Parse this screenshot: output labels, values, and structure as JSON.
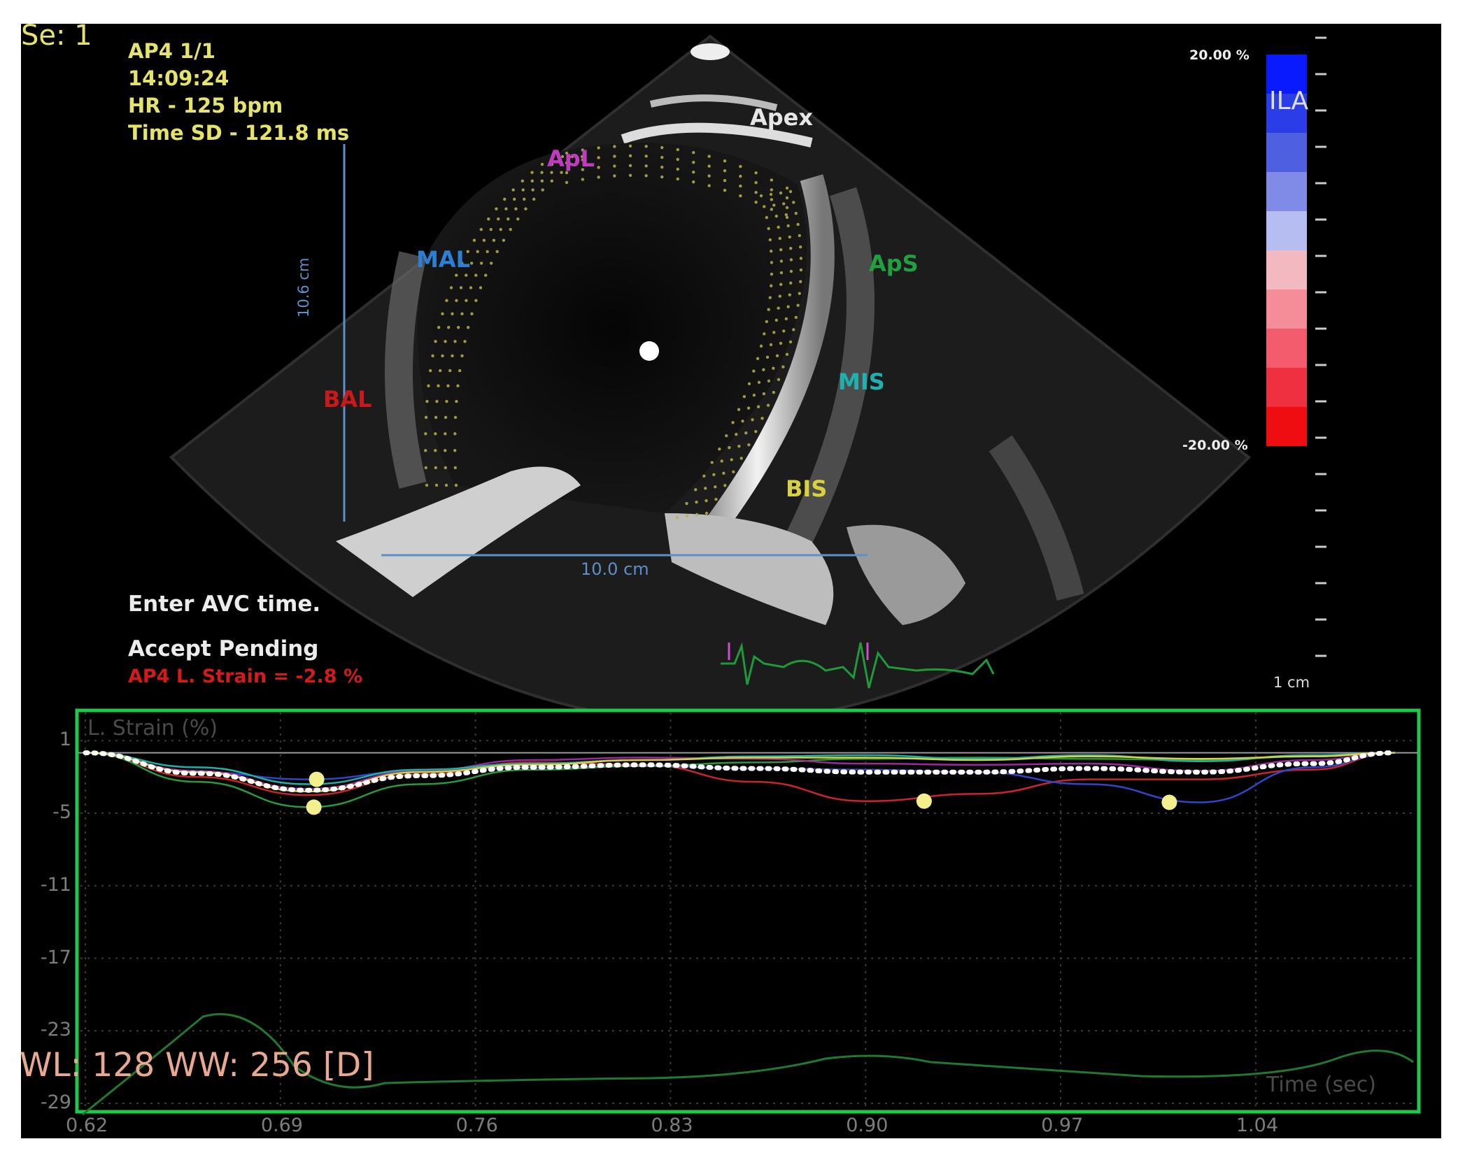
{
  "header": {
    "series": "Se: 1",
    "view": "AP4  1/1",
    "time": "14:09:24",
    "heart_rate": "HR - 125 bpm",
    "time_sd": "Time SD - 121.8 ms"
  },
  "image_labels": {
    "apex": "Apex",
    "apl": "ApL",
    "aps": "ApS",
    "mal": "MAL",
    "mis": "MIS",
    "bal": "BAL",
    "bis": "BIS",
    "depth": "10.6 cm",
    "width": "10.0 cm"
  },
  "color_scale": {
    "max_label": "20.00 %",
    "min_label": "-20.00 %",
    "overlay": "ILA",
    "depth_scale": "1 cm",
    "colors": [
      "#0a1aff",
      "#2a3de6",
      "#4e5fe0",
      "#7f8be6",
      "#b6bdf0",
      "#f3b9c1",
      "#f58d99",
      "#f25c6d",
      "#ef3040",
      "#f00d12"
    ]
  },
  "messages": {
    "prompt": "Enter AVC time.",
    "status": "Accept Pending",
    "strain": "AP4 L. Strain = -2.8 %"
  },
  "ecg_color": "#1f9a3a",
  "window_level": "WL: 128 WW: 256 [D]",
  "chart_data": {
    "type": "line",
    "ylabel": "L. Strain (%)",
    "xlabel": "Time (sec)",
    "yticks": [
      "1",
      "-5",
      "-11",
      "-17",
      "-23",
      "-29"
    ],
    "xticks": [
      "0.62",
      "0.69",
      "0.76",
      "0.83",
      "0.90",
      "0.97",
      "1.04"
    ],
    "xlim": [
      0.62,
      1.092
    ],
    "ylim": [
      -30.5,
      2
    ],
    "x": [
      0.62,
      0.66,
      0.7,
      0.74,
      0.78,
      0.82,
      0.86,
      0.9,
      0.94,
      0.98,
      1.02,
      1.06,
      1.09
    ],
    "series": [
      {
        "color": "#c9252c",
        "values": [
          0,
          -2,
          -3.5,
          -1.8,
          -0.8,
          -1,
          -2.4,
          -4,
          -3.4,
          -2.2,
          -2.2,
          -1.4,
          0
        ]
      },
      {
        "color": "#3045c8",
        "values": [
          0,
          -1.6,
          -2.2,
          -1.5,
          -1.2,
          -1.1,
          -1.3,
          -1.4,
          -1.6,
          -2.6,
          -4.1,
          -1.2,
          0
        ]
      },
      {
        "color": "#2a9a3a",
        "values": [
          0,
          -2.4,
          -4.5,
          -2.6,
          -1.4,
          -1.1,
          -0.8,
          -0.5,
          -0.4,
          -0.5,
          -0.6,
          -0.3,
          0
        ]
      },
      {
        "color": "#9a2a9a",
        "values": [
          0,
          -1.5,
          -3,
          -1.5,
          -0.6,
          -0.4,
          -0.5,
          -0.9,
          -1,
          -0.9,
          -1.5,
          -0.6,
          0
        ]
      },
      {
        "color": "#1fb0a8",
        "values": [
          0,
          -1.2,
          -2.6,
          -1.4,
          -0.9,
          -0.6,
          -0.3,
          -0.2,
          -0.5,
          -0.2,
          -0.7,
          -0.2,
          0
        ]
      },
      {
        "color": "#d8d040",
        "values": [
          0,
          -1.6,
          -3.2,
          -1.6,
          -1,
          -0.6,
          -0.4,
          -0.4,
          -0.6,
          -0.3,
          -0.5,
          -0.3,
          0
        ]
      },
      {
        "color": "#ffffff",
        "dotted": true,
        "values": [
          0,
          -1.7,
          -3.1,
          -1.9,
          -1.2,
          -1.0,
          -1.3,
          -1.6,
          -1.6,
          -1.3,
          -1.6,
          -0.9,
          0
        ]
      }
    ],
    "peak_markers": [
      {
        "x": 0.703,
        "y": -2.2
      },
      {
        "x": 0.702,
        "y": -4.5
      },
      {
        "x": 0.921,
        "y": -4
      },
      {
        "x": 1.009,
        "y": -4.1
      }
    ]
  }
}
